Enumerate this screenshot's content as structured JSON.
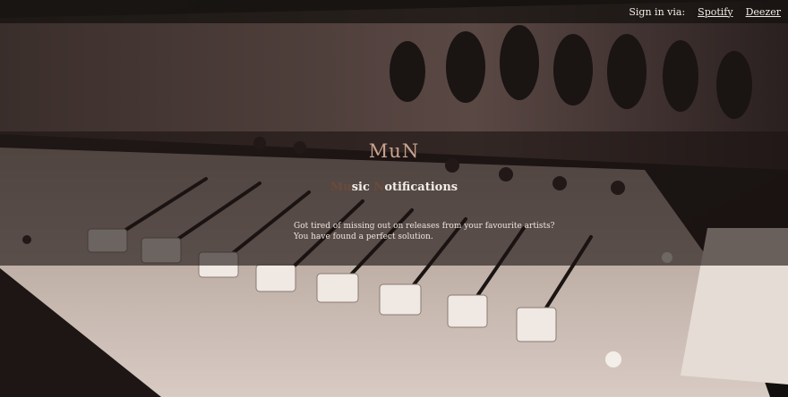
{
  "nav": {
    "signin_label": "Sign in via:",
    "links": [
      "Spotify",
      "Deezer"
    ]
  },
  "hero": {
    "logo": "MuN",
    "subtitle_dim_1": "Mu",
    "subtitle_1": "sic ",
    "subtitle_dim_2": "N",
    "subtitle_2": "otifications",
    "line1": "Got tired of missing out on releases from your favourite artists?",
    "line2": "You have found a perfect solution."
  },
  "colors": {
    "overlay": "#1c1412",
    "logo": "#c9a28e",
    "text": "#f2ece6"
  }
}
